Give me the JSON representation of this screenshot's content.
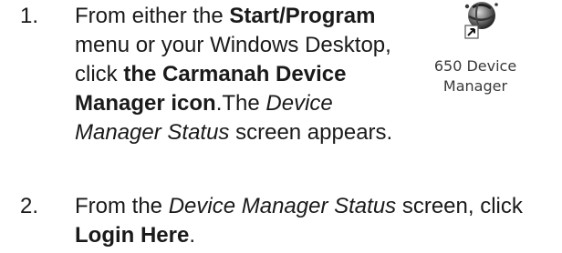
{
  "step1": {
    "number": "1.",
    "line1_pre": "From either the ",
    "line1_bold": "Start/Program",
    "line2": "menu or your Windows Desktop,",
    "line3_pre": "click ",
    "line3_bold": "the Carmanah Device",
    "line4_bold": "Manager icon",
    "line4_post": ".The ",
    "line4_italic": "Device",
    "line5_italic": "Manager Status",
    "line5_post": " screen appears."
  },
  "step2": {
    "number": "2.",
    "line1_pre": "From the ",
    "line1_italic": "Device Manager Status",
    "line1_post": " screen, click",
    "line2_bold": "Login Here",
    "line2_post": "."
  },
  "desktop_icon": {
    "icon": "device-manager-globe-icon",
    "caption_line1": "650 Device",
    "caption_line2": "Manager"
  }
}
